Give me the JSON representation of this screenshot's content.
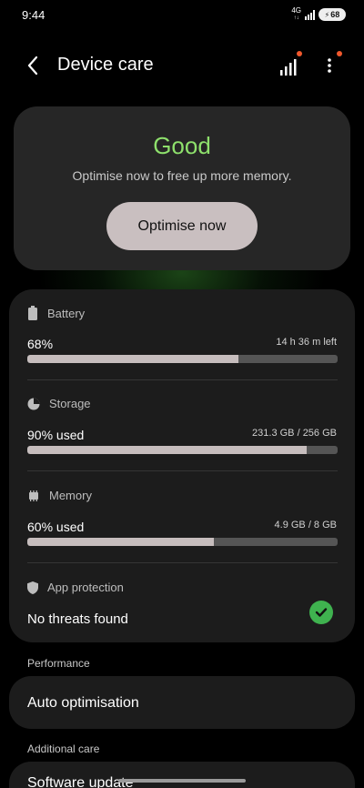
{
  "status_bar": {
    "time": "9:44",
    "network_top": "4G",
    "network_bottom": "↑↓",
    "battery": "68"
  },
  "header": {
    "title": "Device care"
  },
  "status_card": {
    "status": "Good",
    "message": "Optimise now to free up more memory.",
    "button_label": "Optimise now"
  },
  "metrics": {
    "battery": {
      "title": "Battery",
      "value": "68%",
      "detail": "14 h 36 m left",
      "percent": 68
    },
    "storage": {
      "title": "Storage",
      "value": "90% used",
      "detail": "231.3 GB / 256 GB",
      "percent": 90
    },
    "memory": {
      "title": "Memory",
      "value": "60% used",
      "detail": "4.9 GB / 8 GB",
      "percent": 60
    },
    "app_protection": {
      "title": "App protection",
      "value": "No threats found"
    }
  },
  "performance": {
    "header": "Performance",
    "auto_optimisation": "Auto optimisation"
  },
  "additional_care": {
    "header": "Additional care",
    "software_update": "Software update"
  },
  "colors": {
    "good": "#8ee06c",
    "card": "#1c1c1c",
    "bar_fill": "#c6bdbd",
    "check": "#3fb24f",
    "notif": "#f0582d"
  }
}
